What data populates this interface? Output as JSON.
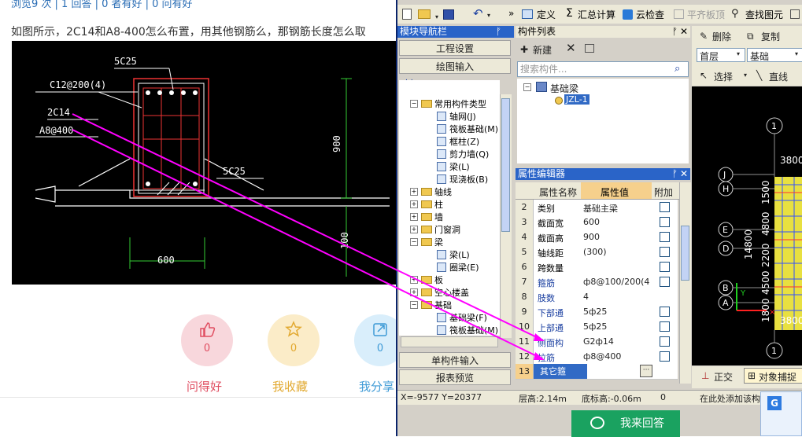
{
  "page": {
    "top_stats": "浏览9 次 | 1 回答 | 0 者有好 | 0 问有好",
    "question": "如图所示，2C14和A8-400怎么布置，用其他钢筋么，那钢筋长度怎么取",
    "cad": {
      "labels": [
        "5C25",
        "C12@200(4)",
        "2C14",
        "A8@400",
        "900",
        "5C25",
        "100",
        "600"
      ]
    },
    "actions": [
      {
        "name": "question-good",
        "count": "0",
        "label": "问得好",
        "color": "#f8d7dc",
        "fg": "#e04e61"
      },
      {
        "name": "my-favorite",
        "count": "0",
        "label": "我收藏",
        "color": "#fbecc8",
        "fg": "#e2a930"
      },
      {
        "name": "my-share",
        "count": "0",
        "label": "我分享",
        "color": "#d9eefb",
        "fg": "#3e9ad6"
      }
    ],
    "answer_button": "我来回答"
  },
  "app": {
    "toolbar": {
      "define": "定义",
      "summary_calc": "汇总计算",
      "cloud_check": "云检查",
      "flat_top": "平齐板顶",
      "find_element": "查找图元",
      "more": "»"
    },
    "module_nav": {
      "title": "模块导航栏",
      "project_settings": "工程设置",
      "drawing_input": "绘图输入",
      "single_input": "单构件输入",
      "report_preview": "报表预览",
      "tree": [
        {
          "label": "常用构件类型",
          "kind": "folder",
          "level": 0,
          "expanded": true
        },
        {
          "label": "轴网(J)",
          "kind": "item",
          "level": 1
        },
        {
          "label": "筏板基础(M)",
          "kind": "item",
          "level": 1
        },
        {
          "label": "框柱(Z)",
          "kind": "item",
          "level": 1
        },
        {
          "label": "剪力墙(Q)",
          "kind": "item",
          "level": 1
        },
        {
          "label": "梁(L)",
          "kind": "item",
          "level": 1
        },
        {
          "label": "现浇板(B)",
          "kind": "item",
          "level": 1
        },
        {
          "label": "轴线",
          "kind": "folder",
          "level": 0,
          "expanded": false
        },
        {
          "label": "柱",
          "kind": "folder",
          "level": 0,
          "expanded": false
        },
        {
          "label": "墙",
          "kind": "folder",
          "level": 0,
          "expanded": false
        },
        {
          "label": "门窗洞",
          "kind": "folder",
          "level": 0,
          "expanded": false
        },
        {
          "label": "梁",
          "kind": "folder",
          "level": 0,
          "expanded": true
        },
        {
          "label": "梁(L)",
          "kind": "item",
          "level": 1
        },
        {
          "label": "圈梁(E)",
          "kind": "item",
          "level": 1
        },
        {
          "label": "板",
          "kind": "folder",
          "level": 0,
          "expanded": false
        },
        {
          "label": "空心楼盖",
          "kind": "folder",
          "level": 0,
          "expanded": false
        },
        {
          "label": "基础",
          "kind": "folder",
          "level": 0,
          "expanded": true
        },
        {
          "label": "基础梁(F)",
          "kind": "item",
          "level": 1
        },
        {
          "label": "筏板基础(M)",
          "kind": "item",
          "level": 1
        }
      ]
    },
    "component_list": {
      "title": "构件列表",
      "new_label": "新建",
      "search_placeholder": "搜索构件...",
      "tree_root": "基础梁",
      "tree_child": "JZL-1"
    },
    "property_editor": {
      "title": "属性编辑器",
      "col_name": "属性名称",
      "col_value": "属性值",
      "col_extra": "附加",
      "rows": [
        {
          "no": "2",
          "name": "类别",
          "value": "基础主梁",
          "blue": false,
          "check": true
        },
        {
          "no": "3",
          "name": "截面宽",
          "value": "600",
          "blue": false,
          "check": true
        },
        {
          "no": "4",
          "name": "截面高",
          "value": "900",
          "blue": false,
          "check": true
        },
        {
          "no": "5",
          "name": "轴线距",
          "value": "(300)",
          "blue": false,
          "check": true
        },
        {
          "no": "6",
          "name": "跨数量",
          "value": "",
          "blue": false,
          "check": true
        },
        {
          "no": "7",
          "name": "箍筋",
          "value": "ф8@100/200(4",
          "blue": true,
          "check": true
        },
        {
          "no": "8",
          "name": "肢数",
          "value": "4",
          "blue": true,
          "check": false
        },
        {
          "no": "9",
          "name": "下部通",
          "value": "5ф25",
          "blue": true,
          "check": true
        },
        {
          "no": "10",
          "name": "上部通",
          "value": "5ф25",
          "blue": true,
          "check": true
        },
        {
          "no": "11",
          "name": "侧面构",
          "value": "G2ф14",
          "blue": true,
          "check": true
        },
        {
          "no": "12",
          "name": "拉筋",
          "value": "ф8@400",
          "blue": true,
          "check": true
        },
        {
          "no": "13",
          "name": "其它箍",
          "value": "",
          "blue": false,
          "check": false,
          "selected": true
        }
      ]
    },
    "right_panel": {
      "delete": "删除",
      "copy": "复制",
      "floor": "首层",
      "category": "基础",
      "select": "选择",
      "line": "直线",
      "ortho": "正交",
      "snap": "对象捕捉",
      "hint": "在此处添加该构",
      "axis_labels": [
        "1",
        "J",
        "H",
        "E",
        "D",
        "B",
        "A",
        "1"
      ],
      "dims": [
        "3800",
        "14800",
        "1800",
        "4500",
        "2200",
        "4800",
        "1500",
        "3800"
      ]
    },
    "status": {
      "coords": "X=-9577 Y=20377",
      "floor_height": "层高:2.14m",
      "bottom_elev": "底标高:-0.06m",
      "zero": "0"
    }
  }
}
